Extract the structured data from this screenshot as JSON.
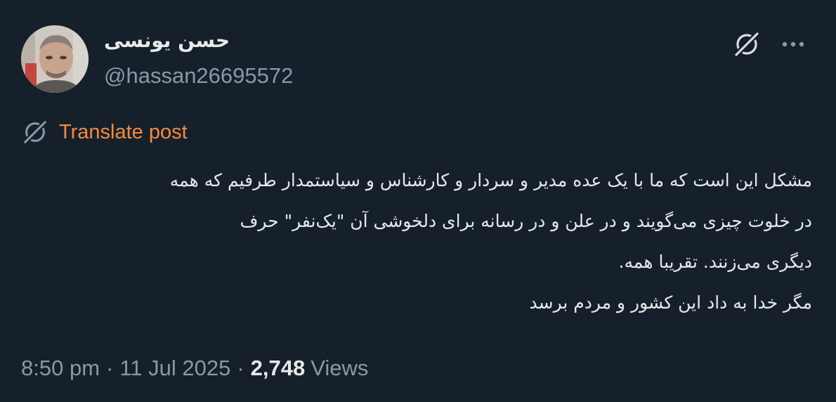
{
  "author": {
    "display_name": "حسن یونسی",
    "handle": "@hassan26695572"
  },
  "actions": {
    "grok_icon": "grok-slash-circle-icon",
    "more_icon": "horizontal-ellipsis-icon"
  },
  "translate": {
    "label": "Translate post"
  },
  "post": {
    "lines": [
      "مشکل این است که ما با یک عده مدیر و سردار و کارشناس و سیاستمدار طرفیم که همه",
      "در خلوت چیزی می‌گویند و در علن و در رسانه برای دلخوشی آن \"یک‌نفر\" حرف",
      "دیگری می‌زنند. تقریبا همه.",
      "مگر خدا به داد این کشور و مردم برسد"
    ]
  },
  "meta": {
    "time": "8:50 pm",
    "separator": "·",
    "date": "11 Jul 2025",
    "views_count": "2,748",
    "views_label": "Views"
  },
  "colors": {
    "background": "#15202b",
    "primary_text": "#e7e9ea",
    "secondary_text": "#8b98a5",
    "translate_accent": "#f58a3d"
  }
}
